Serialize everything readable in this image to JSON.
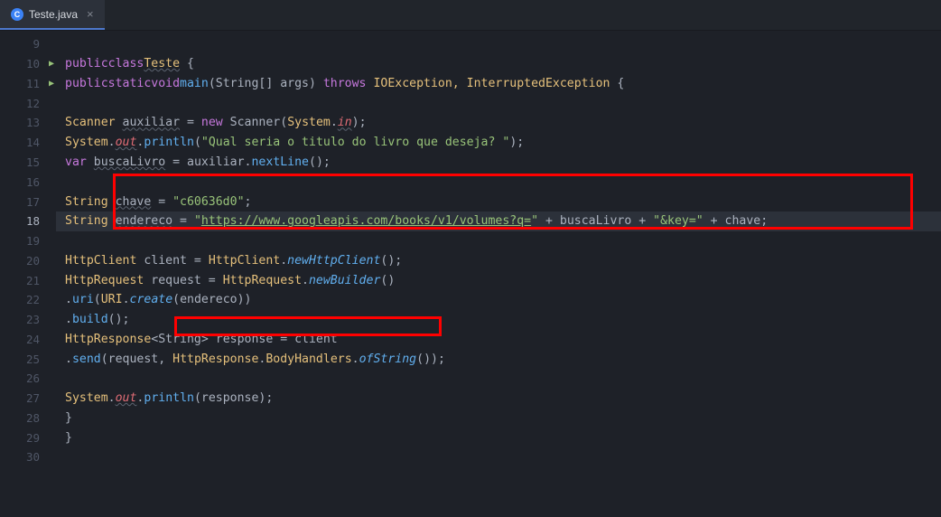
{
  "tab": {
    "filename": "Teste.java",
    "icon_letter": "C"
  },
  "gutter": {
    "start": 9,
    "end": 30,
    "current": 18,
    "run_markers": [
      10,
      11
    ]
  },
  "code": {
    "l10": {
      "kw1": "public",
      "kw2": "class",
      "cls": "Teste",
      "brace": " {"
    },
    "l11": {
      "kw1": "public",
      "kw2": "static",
      "kw3": "void",
      "fn": "main",
      "args": "(String[] args)",
      "kw4": " throws ",
      "ex": "IOException, InterruptedException",
      "brace": " {"
    },
    "l13": {
      "type": "Scanner ",
      "var": "auxiliar",
      "eq": " = ",
      "kw": "new",
      "ctor": " Scanner(",
      "sys": "System",
      "dot": ".",
      "field": "in",
      "end": ");"
    },
    "l14": {
      "sys": "System",
      "d1": ".",
      "out": "out",
      "d2": ".",
      "fn": "println",
      "op": "(",
      "str": "\"Qual seria o titulo do livro que deseja? \"",
      "end": ");"
    },
    "l15": {
      "kw": "var",
      "sp": " ",
      "var": "buscaLivro",
      "eq": " = auxiliar.",
      "fn": "nextLine",
      "end": "();"
    },
    "l17": {
      "type": "String ",
      "var": "chave",
      "eq": " = ",
      "str": "\"c60636d0\"",
      "end": ";"
    },
    "l18": {
      "type": "String ",
      "var": "endereco",
      "eq": " = ",
      "q1": "\"",
      "url": "https://www.googleapis.com/books/v1/volumes?q=",
      "q2": "\"",
      "plus1": " + buscaLivro + ",
      "str2": "\"&key=\"",
      "plus2": " + chave;"
    },
    "l20": {
      "type": "HttpClient",
      "var": " client = ",
      "cls": "HttpClient",
      "dot": ".",
      "fn": "newHttpClient",
      "end": "();"
    },
    "l21": {
      "type": "HttpRequest",
      "var": " request = ",
      "cls": "HttpRequest",
      "dot": ".",
      "fn": "newBuilder",
      "end": "()"
    },
    "l22": {
      "dot": ".",
      "fn": "uri",
      "op": "(",
      "cls": "URI",
      "d2": ".",
      "fn2": "create",
      "args": "(endereco))"
    },
    "l23": {
      "dot": ".",
      "fn": "build",
      "end": "();"
    },
    "l24": {
      "type": "HttpResponse",
      "gen": "<String>",
      "var": " response = client"
    },
    "l25": {
      "dot": ".",
      "fn": "send",
      "args": "(request, ",
      "cls": "HttpResponse",
      "d2": ".",
      "cls2": "BodyHandlers",
      "d3": ".",
      "fn2": "ofString",
      "end": "());"
    },
    "l27": {
      "sys": "System",
      "d1": ".",
      "out": "out",
      "d2": ".",
      "fn": "println",
      "args": "(response);"
    },
    "l28": {
      "brace": "}"
    },
    "l29": {
      "brace": "}"
    }
  }
}
